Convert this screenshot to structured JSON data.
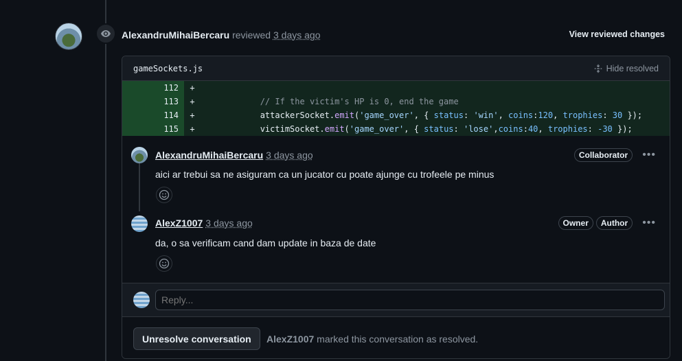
{
  "review": {
    "author": "AlexandruMihaiBercaru",
    "action": "reviewed",
    "time": "3 days ago",
    "view_changes_label": "View reviewed changes"
  },
  "file": {
    "name": "gameSockets.js",
    "hide_resolved_label": "Hide resolved"
  },
  "diff_lines": [
    {
      "num": "112",
      "sign": "+"
    },
    {
      "num": "113",
      "sign": "+"
    },
    {
      "num": "114",
      "sign": "+"
    },
    {
      "num": "115",
      "sign": "+"
    }
  ],
  "code": {
    "l113": "// If the victim's HP is 0, end the game",
    "l114_obj": "attackerSocket",
    "l114_fn": "emit",
    "l114_ev": "'game_over'",
    "l114_k1": "status",
    "l114_v1": "'win'",
    "l114_k2": "coins",
    "l114_v2": "120",
    "l114_k3": "trophies",
    "l114_v3": "30",
    "l115_obj": "victimSocket",
    "l115_fn": "emit",
    "l115_ev": "'game_over'",
    "l115_k1": "status",
    "l115_v1": "'lose'",
    "l115_k2": "coins",
    "l115_v2": "40",
    "l115_k3": "trophies",
    "l115_v3": "-30"
  },
  "comments": [
    {
      "author": "AlexandruMihaiBercaru",
      "time": "3 days ago",
      "badges": [
        "Collaborator"
      ],
      "body": "aici ar trebui sa ne asiguram ca un jucator cu poate ajunge cu trofeele pe minus"
    },
    {
      "author": "AlexZ1007",
      "time": "3 days ago",
      "badges": [
        "Owner",
        "Author"
      ],
      "body": "da, o sa verificam cand dam update in baza de date"
    }
  ],
  "reply": {
    "placeholder": "Reply..."
  },
  "resolve": {
    "button_label": "Unresolve conversation",
    "resolver": "AlexZ1007",
    "note": "marked this conversation as resolved."
  },
  "colors": {
    "background": "#0d1117",
    "diff_added": "#12261e",
    "text": "#e6edf3",
    "muted": "#8d96a0"
  }
}
